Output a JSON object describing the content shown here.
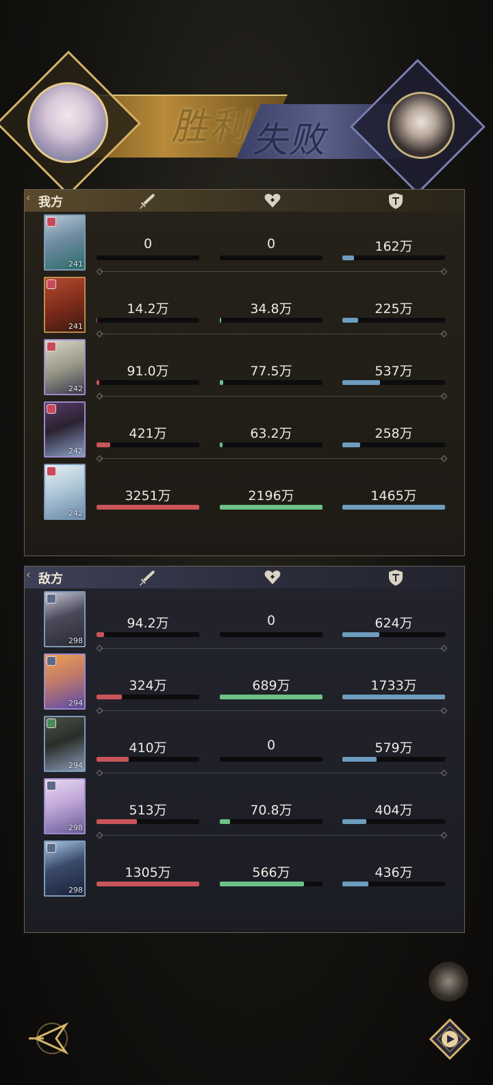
{
  "banner": {
    "victory_label": "胜利",
    "defeat_label": "失败"
  },
  "colors": {
    "attack_bar": "#c9545a",
    "heal_bar": "#6cc088",
    "defense_bar": "#6e9cbe",
    "gold_accent": "#d6b468"
  },
  "icons": {
    "attack": "sword-icon",
    "heal": "heart-icon",
    "defense": "shield-icon",
    "back": "back-arrow-icon",
    "replay": "replay-icon"
  },
  "our_team": {
    "title": "我方",
    "heroes": [
      {
        "level": "241",
        "attack": "0",
        "attack_ratio": 0.0,
        "heal": "0",
        "heal_ratio": 0.0,
        "defense": "162万",
        "defense_ratio": 0.11
      },
      {
        "level": "241",
        "attack": "14.2万",
        "attack_ratio": 0.004,
        "heal": "34.8万",
        "heal_ratio": 0.016,
        "defense": "225万",
        "defense_ratio": 0.154
      },
      {
        "level": "242",
        "attack": "91.0万",
        "attack_ratio": 0.028,
        "heal": "77.5万",
        "heal_ratio": 0.035,
        "defense": "537万",
        "defense_ratio": 0.367
      },
      {
        "level": "242",
        "attack": "421万",
        "attack_ratio": 0.13,
        "heal": "63.2万",
        "heal_ratio": 0.029,
        "defense": "258万",
        "defense_ratio": 0.176
      },
      {
        "level": "242",
        "attack": "3251万",
        "attack_ratio": 1.0,
        "heal": "2196万",
        "heal_ratio": 1.0,
        "defense": "1465万",
        "defense_ratio": 1.0
      }
    ]
  },
  "enemy_team": {
    "title": "敌方",
    "heroes": [
      {
        "level": "298",
        "attack": "94.2万",
        "attack_ratio": 0.072,
        "heal": "0",
        "heal_ratio": 0.0,
        "defense": "624万",
        "defense_ratio": 0.36
      },
      {
        "level": "294",
        "attack": "324万",
        "attack_ratio": 0.248,
        "heal": "689万",
        "heal_ratio": 1.0,
        "defense": "1733万",
        "defense_ratio": 1.0
      },
      {
        "level": "294",
        "attack": "410万",
        "attack_ratio": 0.314,
        "heal": "0",
        "heal_ratio": 0.0,
        "defense": "579万",
        "defense_ratio": 0.334
      },
      {
        "level": "298",
        "attack": "513万",
        "attack_ratio": 0.393,
        "heal": "70.8万",
        "heal_ratio": 0.103,
        "defense": "404万",
        "defense_ratio": 0.233
      },
      {
        "level": "298",
        "attack": "1305万",
        "attack_ratio": 1.0,
        "heal": "566万",
        "heal_ratio": 0.821,
        "defense": "436万",
        "defense_ratio": 0.252
      }
    ]
  }
}
